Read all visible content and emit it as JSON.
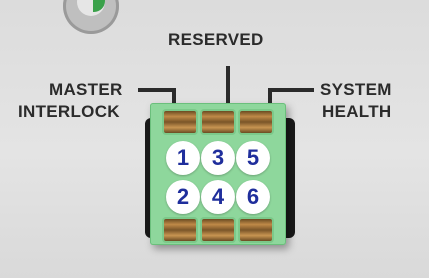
{
  "labels": {
    "reserved": "RESERVED",
    "master": "MASTER",
    "interlock": "INTERLOCK",
    "system": "SYSTEM",
    "health": "HEALTH"
  },
  "pins": [
    "1",
    "3",
    "5",
    "2",
    "4",
    "6"
  ],
  "colors": {
    "terminal": "#8ed79c",
    "pin_text": "#1f2e9c",
    "label_text": "#2b2b2b",
    "panel": "#dcdcdc"
  }
}
